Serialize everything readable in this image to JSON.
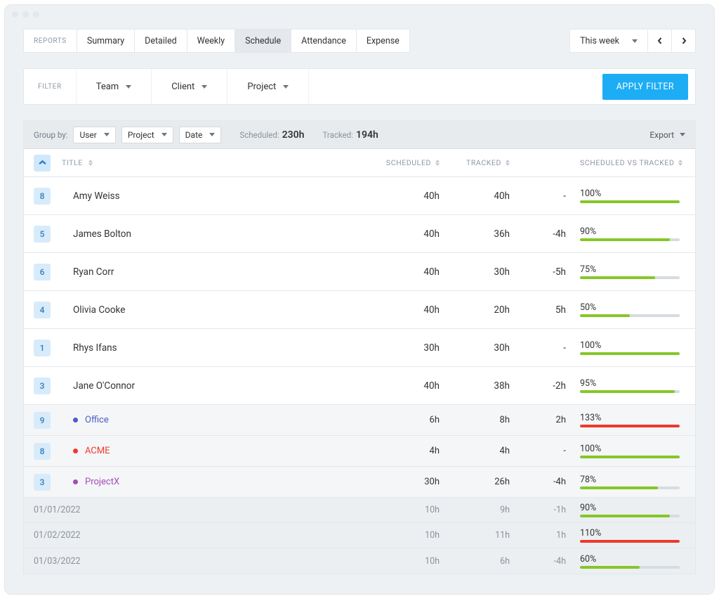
{
  "tabs": {
    "label": "REPORTS",
    "items": [
      "Summary",
      "Detailed",
      "Weekly",
      "Schedule",
      "Attendance",
      "Expense"
    ],
    "active_index": 3
  },
  "date_range": {
    "label": "This week"
  },
  "filter": {
    "label": "FILTER",
    "dropdowns": [
      "Team",
      "Client",
      "Project"
    ],
    "apply_label": "APPLY FILTER"
  },
  "group_bar": {
    "group_by_label": "Group by:",
    "groups": [
      "User",
      "Project",
      "Date"
    ],
    "scheduled_label": "Scheduled:",
    "scheduled_value": "230h",
    "tracked_label": "Tracked:",
    "tracked_value": "194h",
    "export_label": "Export"
  },
  "columns": {
    "title": "TITLE",
    "scheduled": "SCHEDULED",
    "tracked": "TRACKED",
    "vs": "SCHEDULED VS TRACKED"
  },
  "rows": [
    {
      "type": "user",
      "badge": "8",
      "title": "Amy Weiss",
      "scheduled": "40h",
      "tracked": "40h",
      "diff": "-",
      "pct": "100%",
      "fill": 100,
      "color": "#85c728"
    },
    {
      "type": "user",
      "badge": "5",
      "title": "James Bolton",
      "scheduled": "40h",
      "tracked": "36h",
      "diff": "-4h",
      "pct": "90%",
      "fill": 90,
      "color": "#85c728"
    },
    {
      "type": "user",
      "badge": "6",
      "title": "Ryan Corr",
      "scheduled": "40h",
      "tracked": "30h",
      "diff": "-5h",
      "pct": "75%",
      "fill": 75,
      "color": "#85c728"
    },
    {
      "type": "user",
      "badge": "4",
      "title": "Olivia Cooke",
      "scheduled": "40h",
      "tracked": "20h",
      "diff": "5h",
      "pct": "50%",
      "fill": 50,
      "color": "#85c728"
    },
    {
      "type": "user",
      "badge": "1",
      "title": "Rhys Ifans",
      "scheduled": "30h",
      "tracked": "30h",
      "diff": "-",
      "pct": "100%",
      "fill": 100,
      "color": "#85c728"
    },
    {
      "type": "user",
      "badge": "3",
      "title": "Jane O'Connor",
      "scheduled": "40h",
      "tracked": "38h",
      "diff": "-2h",
      "pct": "95%",
      "fill": 95,
      "color": "#85c728"
    },
    {
      "type": "project",
      "badge": "9",
      "title": "Office",
      "dot": "#4b5cc4",
      "tcolor": "#4b5cc4",
      "scheduled": "6h",
      "tracked": "8h",
      "diff": "2h",
      "pct": "133%",
      "fill": 100,
      "color": "#f0392b"
    },
    {
      "type": "project",
      "badge": "8",
      "title": "ACME",
      "dot": "#f0392b",
      "tcolor": "#f0392b",
      "scheduled": "4h",
      "tracked": "4h",
      "diff": "-",
      "pct": "100%",
      "fill": 100,
      "color": "#85c728"
    },
    {
      "type": "project",
      "badge": "3",
      "title": "ProjectX",
      "dot": "#a34db6",
      "tcolor": "#a34db6",
      "scheduled": "30h",
      "tracked": "26h",
      "diff": "-4h",
      "pct": "78%",
      "fill": 78,
      "color": "#85c728"
    },
    {
      "type": "date",
      "title": "01/01/2022",
      "scheduled": "10h",
      "tracked": "9h",
      "diff": "-1h",
      "pct": "90%",
      "fill": 90,
      "color": "#85c728"
    },
    {
      "type": "date",
      "title": "01/02/2022",
      "scheduled": "10h",
      "tracked": "11h",
      "diff": "1h",
      "pct": "110%",
      "fill": 100,
      "color": "#f0392b"
    },
    {
      "type": "date",
      "title": "01/03/2022",
      "scheduled": "10h",
      "tracked": "6h",
      "diff": "-4h",
      "pct": "60%",
      "fill": 60,
      "color": "#85c728"
    }
  ]
}
